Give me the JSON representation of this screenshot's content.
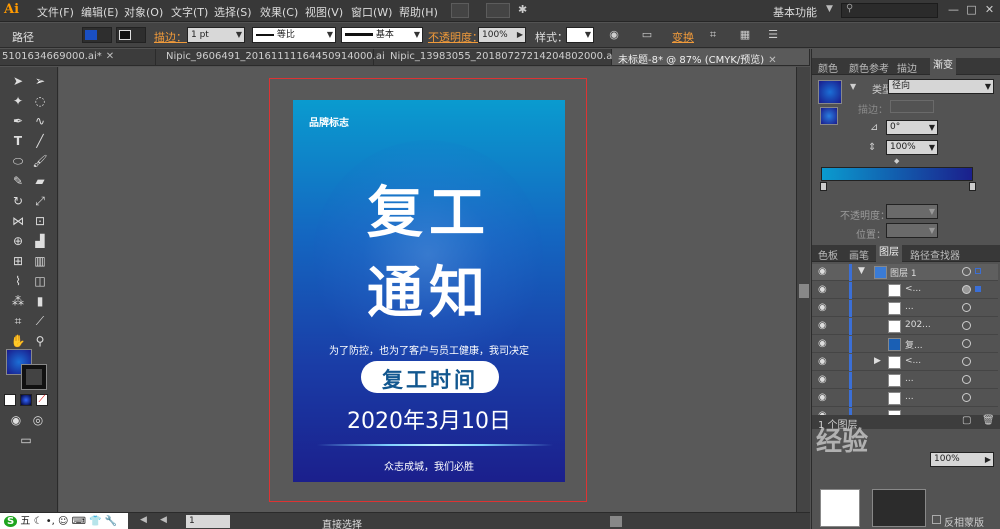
{
  "app": {
    "logo": "Ai",
    "menus": [
      "文件(F)",
      "编辑(E)",
      "对象(O)",
      "文字(T)",
      "选择(S)",
      "效果(C)",
      "视图(V)",
      "窗口(W)",
      "帮助(H)"
    ],
    "workspace": "基本功能",
    "window_controls": [
      "—",
      "□",
      "✕"
    ]
  },
  "control_bar": {
    "selection_type": "路径",
    "stroke_label": "描边：",
    "stroke_weight": "1 pt",
    "profile_1": "等比",
    "profile_2": "基本",
    "opacity_label": "不透明度：",
    "opacity_value": "100%",
    "style_label": "样式：",
    "transform_label": "变换"
  },
  "tabs": [
    {
      "label": "5101634669000.ai*",
      "active": false
    },
    {
      "label": "Nipic_9606491_20161111164450914000.ai*",
      "active": false
    },
    {
      "label": "Nipic_13983055_20180727214204802000.ai*",
      "active": false
    },
    {
      "label": "未标题-8* @ 87% (CMYK/预览)",
      "active": true
    }
  ],
  "poster": {
    "brand": "品牌标志",
    "headline_1": "复工",
    "headline_2": "通知",
    "subline": "为了防控，也为了客户与员工健康，我司决定",
    "pill": "复工时间",
    "date": "2020年3月10日",
    "slogan": "众志成城，我们必胜"
  },
  "status_bar": {
    "ime": "五",
    "page": "1",
    "tool": "直接选择"
  },
  "panels": {
    "top_tabs": [
      "颜色",
      "颜色参考",
      "描边",
      "渐变"
    ],
    "type_label": "类型：",
    "type_value": "径向",
    "stroke_label": "描边：",
    "angle_value": "0°",
    "aspect_value": "100%",
    "opacity_label": "不透明度：",
    "position_label": "位置：",
    "layer_tabs": [
      "色板",
      "画笔",
      "图层",
      "路径查找器"
    ],
    "layers": [
      {
        "name": "图层 1",
        "top": true
      },
      {
        "name": "<..."
      },
      {
        "name": "..."
      },
      {
        "name": "202..."
      },
      {
        "name": "复..."
      },
      {
        "name": "<..."
      },
      {
        "name": "..."
      },
      {
        "name": "..."
      },
      {
        "name": "..."
      }
    ],
    "layer_count": "1 个图层",
    "clip_label": "反相蒙版",
    "extra_opacity": "100%",
    "watermark": "经验"
  },
  "colors": {
    "accent": "#ff9a00",
    "link": "#f09a3a",
    "poster_top": "#0a9bcf",
    "poster_bottom": "#1b1f8c",
    "layer_color": "#3b6fd6"
  }
}
